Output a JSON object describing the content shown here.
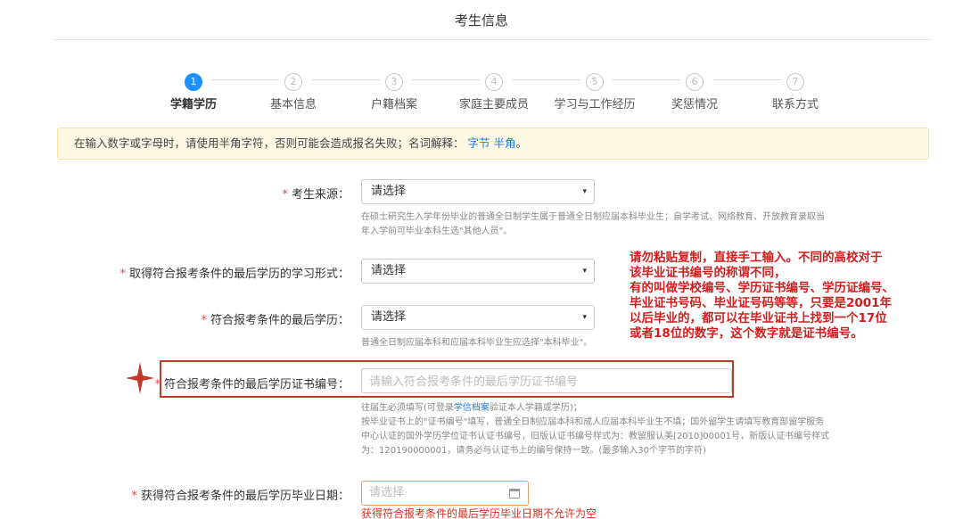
{
  "header": {
    "title": "考生信息"
  },
  "steps": [
    {
      "num": "1",
      "label": "学籍学历",
      "active": true
    },
    {
      "num": "2",
      "label": "基本信息",
      "active": false
    },
    {
      "num": "3",
      "label": "户籍档案",
      "active": false
    },
    {
      "num": "4",
      "label": "家庭主要成员",
      "active": false
    },
    {
      "num": "5",
      "label": "学习与工作经历",
      "active": false
    },
    {
      "num": "6",
      "label": "奖惩情况",
      "active": false
    },
    {
      "num": "7",
      "label": "联系方式",
      "active": false
    }
  ],
  "notice": {
    "text": "在输入数字或字母时，请使用半角字符，否则可能会造成报名失败；名词解释：",
    "link1": "字节",
    "link2": "半角",
    "end": "。"
  },
  "form": {
    "required_mark": "*",
    "source": {
      "label": "考生来源：",
      "value": "请选择",
      "help1": "在硕士研究生入学年份毕业的普通全日制学生属于普通全日制应届本科毕业生；自学考试、网络教育、开放教育录取当",
      "help2": "年入学前可毕业本科生选\"其他人员\"。"
    },
    "study_form": {
      "label": "取得符合报考条件的最后学历的学习形式：",
      "value": "请选择"
    },
    "last_degree": {
      "label": "符合报考条件的最后学历：",
      "value": "请选择",
      "help": "普通全日制应届本科和应届本科毕业生应选择\"本科毕业\"。"
    },
    "cert_no": {
      "label": "符合报考条件的最后学历证书编号：",
      "placeholder": "请输入符合报考条件的最后学历证书编号",
      "help1_pre": "往届生必须填写(可登录",
      "help1_link": "学信档案",
      "help1_post": "验证本人学籍或学历)；",
      "help2": "按毕业证书上的\"证书编号\"填写，普通全日制应届本科和成人应届本科毕业生不填；国外留学生请填写教育部留学服务",
      "help3": "中心认证的国外学历学位证书认证书编号，旧版认证书编号样式为：教留服认美[2010]00001号，新版认证书编号样式",
      "help4": "为：120190000001，请务必与认证书上的编号保持一致。(最多输入30个字节的字符)"
    },
    "grad_date": {
      "label": "获得符合报考条件的最后学历毕业日期：",
      "placeholder": "请选择",
      "error": "获得符合报考条件的最后学历毕业日期不允许为空"
    }
  },
  "annotation": {
    "line1": "请勿粘贴复制，直接手工输入。不同的高校对于",
    "line2": "该毕业证书编号的称谓不同，",
    "line3": "有的叫做学校编号、学历证书编号、学历证编号、",
    "line4": "毕业证书号码、毕业证号码等等，只要是2001年",
    "line5": "以后毕业的，都可以在毕业证书上找到一个17位",
    "line6": "或者18位的数字，这个数字就是证书编号。"
  },
  "colors": {
    "active_step": "#1e90ff",
    "required": "#e0474c",
    "annotation": "#d01e1e",
    "highlight_border": "#c0392b",
    "notice_bg": "#fcf8e3",
    "link": "#1e7bd8"
  },
  "icons": {
    "select_caret": "▾",
    "calendar": "calendar-icon",
    "star": "four-point-star-marker"
  }
}
